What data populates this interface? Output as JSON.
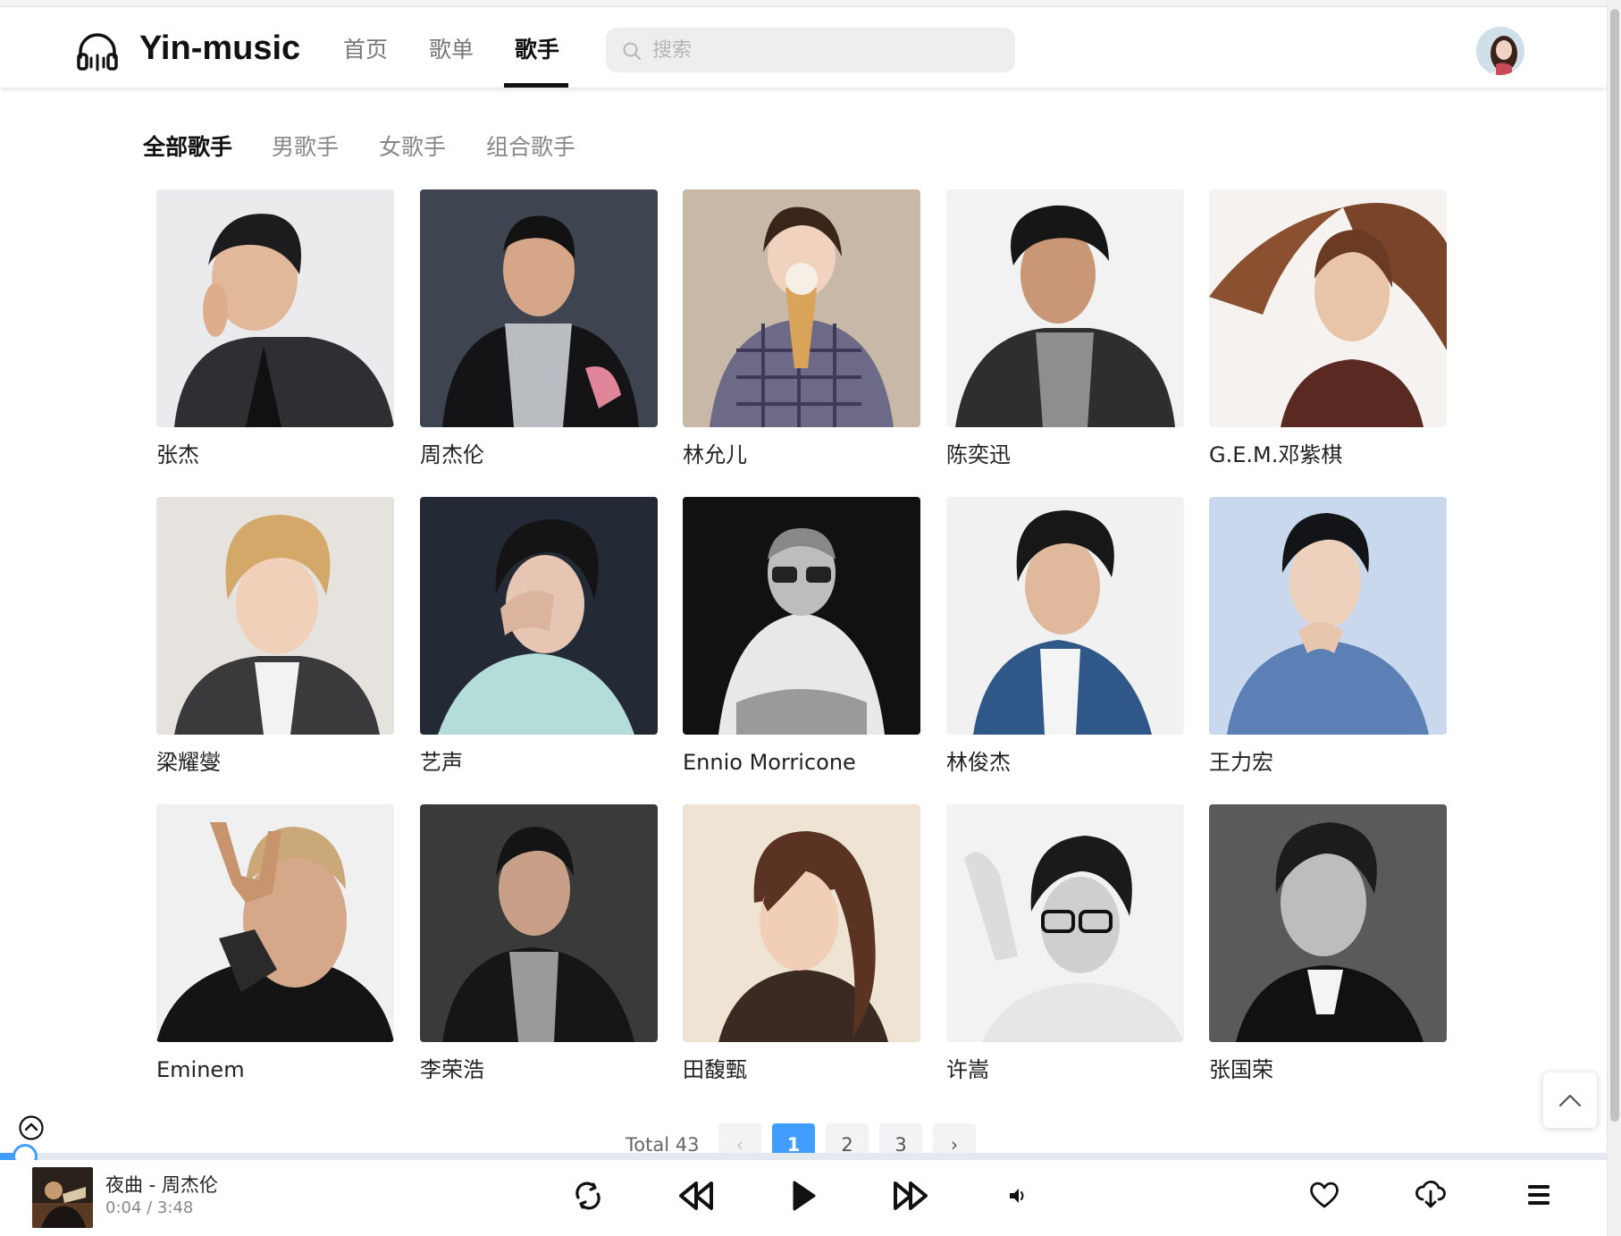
{
  "app": {
    "name": "Yin-music"
  },
  "nav": [
    {
      "label": "首页",
      "active": false
    },
    {
      "label": "歌单",
      "active": false
    },
    {
      "label": "歌手",
      "active": true
    }
  ],
  "search": {
    "placeholder": "搜索"
  },
  "filters": [
    {
      "label": "全部歌手",
      "active": true
    },
    {
      "label": "男歌手",
      "active": false
    },
    {
      "label": "女歌手",
      "active": false
    },
    {
      "label": "组合歌手",
      "active": false
    }
  ],
  "singers": [
    {
      "name": "张杰"
    },
    {
      "name": "周杰伦"
    },
    {
      "name": "林允儿"
    },
    {
      "name": "陈奕迅"
    },
    {
      "name": "G.E.M.邓紫棋"
    },
    {
      "name": "梁耀燮"
    },
    {
      "name": "艺声"
    },
    {
      "name": "Ennio Morricone"
    },
    {
      "name": "林俊杰"
    },
    {
      "name": "王力宏"
    },
    {
      "name": "Eminem"
    },
    {
      "name": "李荣浩"
    },
    {
      "name": "田馥甄"
    },
    {
      "name": "许嵩"
    },
    {
      "name": "张国荣"
    }
  ],
  "pagination": {
    "total_label": "Total 43",
    "pages": [
      "1",
      "2",
      "3"
    ],
    "current": "1",
    "prev": "‹",
    "next": "›"
  },
  "player": {
    "song_title": "夜曲 - 周杰伦",
    "current_time": "0:04",
    "duration": "3:48",
    "time_display": "0:04 / 3:48",
    "progress_fraction": 0.0175
  },
  "colors": {
    "accent": "#409eff",
    "text": "#222222",
    "muted": "#888888"
  },
  "icons": {
    "logo": "headphones-icon",
    "search": "search-icon",
    "back_top": "chevron-up-icon",
    "collapse": "chevron-up-circle-icon",
    "loop": "loop-icon",
    "prev": "rewind-icon",
    "play": "play-icon",
    "next": "fast-forward-icon",
    "volume": "volume-icon",
    "like": "heart-icon",
    "download": "cloud-download-icon",
    "playlist": "list-icon"
  }
}
